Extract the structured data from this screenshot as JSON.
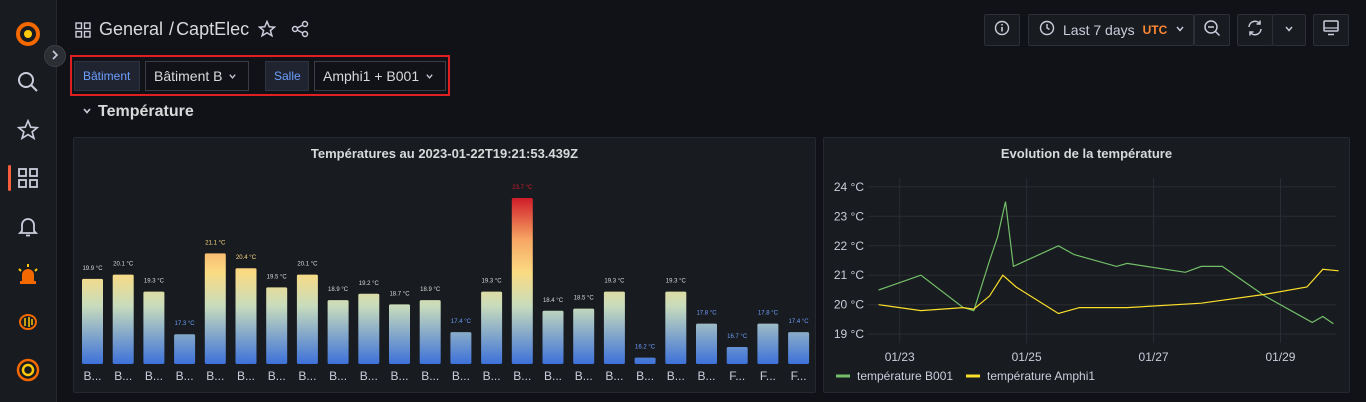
{
  "breadcrumb": {
    "folder": "General",
    "separator": "/",
    "dashboard": "CaptElec"
  },
  "time": {
    "range_label": "Last 7 days",
    "tz": "UTC"
  },
  "variables": [
    {
      "label": "Bâtiment",
      "value": "Bâtiment B"
    },
    {
      "label": "Salle",
      "value": "Amphi1 + B001"
    }
  ],
  "row": {
    "title": "Température"
  },
  "bar_panel": {
    "title": "Températures au 2023-01-22T19:21:53.439Z"
  },
  "line_panel": {
    "title": "Evolution de la température"
  },
  "icons": [
    "grafana-logo-icon",
    "search-icon",
    "star-icon",
    "dashboards-icon",
    "bell-icon",
    "alert-siren-icon",
    "ml-brain-icon",
    "oncall-icon",
    "chevron-right-icon",
    "grid-icon",
    "share-icon",
    "info-icon",
    "clock-icon",
    "zoom-out-icon",
    "refresh-icon",
    "chevron-down-icon",
    "tv-icon"
  ],
  "chart_data": [
    {
      "type": "bar",
      "title": "Températures au 2023-01-22T19:21:53.439Z",
      "unit": "°C",
      "categories": [
        "B...",
        "B...",
        "B...",
        "B...",
        "B...",
        "B...",
        "B...",
        "B...",
        "B...",
        "B...",
        "B...",
        "B...",
        "B...",
        "B...",
        "B...",
        "B...",
        "B...",
        "B...",
        "B...",
        "B...",
        "B...",
        "F...",
        "F...",
        "F..."
      ],
      "values": [
        19.9,
        20.1,
        19.3,
        17.3,
        21.1,
        20.4,
        19.5,
        20.1,
        18.9,
        19.2,
        18.7,
        18.9,
        17.4,
        19.3,
        23.7,
        18.4,
        18.5,
        19.3,
        16.2,
        19.3,
        17.8,
        16.7,
        17.8,
        17.4
      ],
      "value_labels": [
        "19.9 °C",
        "20.1 °C",
        "19.3 °C",
        "17.3 °C",
        "21.1 °C",
        "20.4 °C",
        "19.5 °C",
        "20.1 °C",
        "18.9 °C",
        "19.2 °C",
        "18.7 °C",
        "18.9 °C",
        "17.4 °C",
        "19.3 °C",
        "23.7 °C",
        "18.4 °C",
        "18.5 °C",
        "19.3 °C",
        "16.2 °C",
        "19.3 °C",
        "17.8 °C",
        "16.7 °C",
        "17.8 °C",
        "17.4 °C"
      ]
    },
    {
      "type": "line",
      "title": "Evolution de la température",
      "x_ticks": [
        "01/23",
        "01/25",
        "01/27",
        "01/29"
      ],
      "y_ticks": [
        "19 °C",
        "20 °C",
        "21 °C",
        "22 °C",
        "23 °C",
        "24 °C"
      ],
      "ylim": [
        18.7,
        24.3
      ],
      "x_domain_days": [
        "2023-01-22T12:00Z",
        "2023-01-29T21:00Z"
      ],
      "legend_position": "bottom-left",
      "series": [
        {
          "name": "température B001",
          "color": "#73bf69",
          "points": [
            [
              "2023-01-22T16:00Z",
              20.5
            ],
            [
              "2023-01-23T08:00Z",
              21.0
            ],
            [
              "2023-01-24T00:00Z",
              19.9
            ],
            [
              "2023-01-24T04:00Z",
              19.8
            ],
            [
              "2023-01-24T10:00Z",
              21.5
            ],
            [
              "2023-01-24T13:00Z",
              22.3
            ],
            [
              "2023-01-24T16:00Z",
              23.5
            ],
            [
              "2023-01-24T19:00Z",
              21.3
            ],
            [
              "2023-01-25T12:00Z",
              22.0
            ],
            [
              "2023-01-25T18:00Z",
              21.7
            ],
            [
              "2023-01-26T10:00Z",
              21.3
            ],
            [
              "2023-01-26T14:00Z",
              21.4
            ],
            [
              "2023-01-27T12:00Z",
              21.1
            ],
            [
              "2023-01-27T18:00Z",
              21.3
            ],
            [
              "2023-01-28T02:00Z",
              21.3
            ],
            [
              "2023-01-28T18:00Z",
              20.3
            ],
            [
              "2023-01-29T12:00Z",
              19.4
            ],
            [
              "2023-01-29T16:00Z",
              19.6
            ],
            [
              "2023-01-29T20:00Z",
              19.35
            ]
          ]
        },
        {
          "name": "température Amphi1",
          "color": "#fade2a",
          "points": [
            [
              "2023-01-22T16:00Z",
              20.0
            ],
            [
              "2023-01-23T08:00Z",
              19.8
            ],
            [
              "2023-01-24T00:00Z",
              19.9
            ],
            [
              "2023-01-24T04:00Z",
              19.85
            ],
            [
              "2023-01-24T10:00Z",
              20.3
            ],
            [
              "2023-01-24T15:00Z",
              21.0
            ],
            [
              "2023-01-24T20:00Z",
              20.6
            ],
            [
              "2023-01-25T12:00Z",
              19.7
            ],
            [
              "2023-01-25T20:00Z",
              19.9
            ],
            [
              "2023-01-26T14:00Z",
              19.9
            ],
            [
              "2023-01-27T18:00Z",
              20.05
            ],
            [
              "2023-01-28T18:00Z",
              20.35
            ],
            [
              "2023-01-29T10:00Z",
              20.6
            ],
            [
              "2023-01-29T16:00Z",
              21.2
            ],
            [
              "2023-01-29T22:00Z",
              21.15
            ]
          ]
        }
      ]
    }
  ]
}
